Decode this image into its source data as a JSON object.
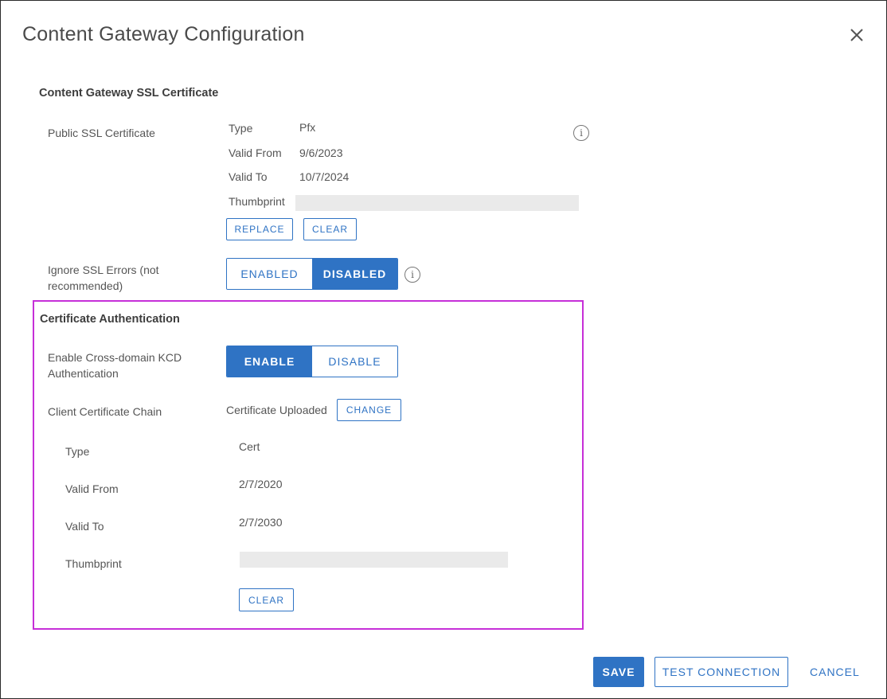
{
  "dialog": {
    "title": "Content Gateway Configuration",
    "close_icon": "close-icon"
  },
  "ssl_section": {
    "heading": "Content Gateway SSL Certificate",
    "public_cert_label": "Public SSL Certificate",
    "type_label": "Type",
    "type_value": "Pfx",
    "valid_from_label": "Valid From",
    "valid_from_value": "9/6/2023",
    "valid_to_label": "Valid To",
    "valid_to_value": "10/7/2024",
    "thumbprint_label": "Thumbprint",
    "replace_label": "REPLACE",
    "clear_label": "CLEAR",
    "info_icon": "info-icon",
    "ignore_label": "Ignore SSL Errors (not recommended)",
    "ignore_toggle": {
      "enabled_label": "ENABLED",
      "disabled_label": "DISABLED",
      "selected": "DISABLED"
    }
  },
  "cert_auth": {
    "heading": "Certificate Authentication",
    "kcd_label": "Enable Cross-domain KCD Authentication",
    "kcd_toggle": {
      "enable_label": "ENABLE",
      "disable_label": "DISABLE",
      "selected": "ENABLE"
    },
    "chain_label": "Client Certificate Chain",
    "chain_status": "Certificate Uploaded",
    "change_label": "CHANGE",
    "type_label": "Type",
    "type_value": "Cert",
    "valid_from_label": "Valid From",
    "valid_from_value": "2/7/2020",
    "valid_to_label": "Valid To",
    "valid_to_value": "2/7/2030",
    "thumbprint_label": "Thumbprint",
    "clear_label": "CLEAR"
  },
  "footer": {
    "save_label": "SAVE",
    "test_label": "TEST CONNECTION",
    "cancel_label": "CANCEL"
  },
  "colors": {
    "accent": "#2f73c4",
    "highlight_border": "#c62fd8"
  }
}
